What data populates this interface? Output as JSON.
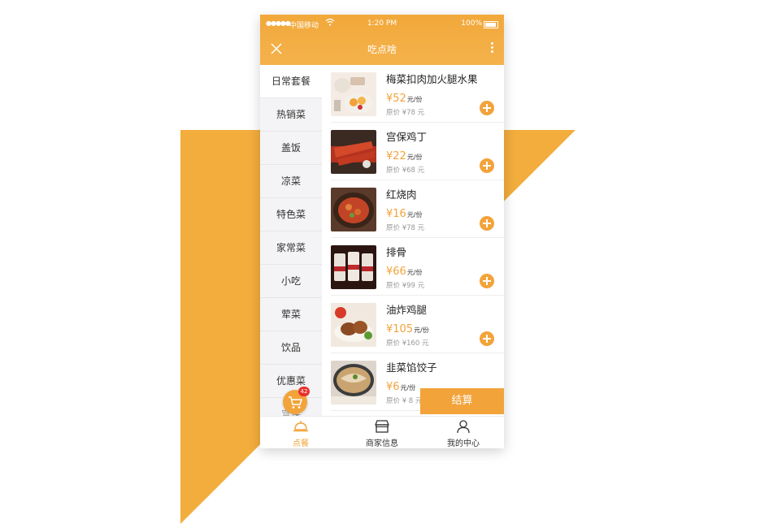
{
  "status_bar": {
    "carrier": "中国移动",
    "time": "1:20 PM",
    "battery": "100%"
  },
  "nav": {
    "title": "吃点啥"
  },
  "categories": [
    {
      "label": "日常套餐"
    },
    {
      "label": "热销菜"
    },
    {
      "label": "盖饭"
    },
    {
      "label": "凉菜"
    },
    {
      "label": "特色菜"
    },
    {
      "label": "家常菜"
    },
    {
      "label": "小吃"
    },
    {
      "label": "荤菜"
    },
    {
      "label": "饮品"
    },
    {
      "label": "优惠菜"
    },
    {
      "label": "宫保"
    }
  ],
  "dishes": [
    {
      "name": "梅菜扣肉加火腿水果",
      "price": "¥52",
      "unit": "元/份",
      "original": "原价 ¥78 元"
    },
    {
      "name": "宫保鸡丁",
      "price": "¥22",
      "unit": "元/份",
      "original": "原价 ¥68 元"
    },
    {
      "name": "红烧肉",
      "price": "¥16",
      "unit": "元/份",
      "original": "原价 ¥78 元"
    },
    {
      "name": "排骨",
      "price": "¥66",
      "unit": "元/份",
      "original": "原价 ¥99 元"
    },
    {
      "name": "油炸鸡腿",
      "price": "¥105",
      "unit": "元/份",
      "original": "原价 ¥160 元"
    },
    {
      "name": "韭菜馅饺子",
      "price": "¥6",
      "unit": "元/份",
      "original": "原价 ¥ 8 元"
    }
  ],
  "cart": {
    "badge": "42",
    "checkout_label": "结算"
  },
  "tabs": [
    {
      "label": "点餐"
    },
    {
      "label": "商家信息"
    },
    {
      "label": "我的中心"
    }
  ],
  "colors": {
    "accent": "#f2a33a",
    "background_shape": "#f2ad3d",
    "badge": "#e8322b"
  },
  "icons": [
    "signal-icon",
    "wifi-icon",
    "battery-icon",
    "close-icon",
    "more-icon",
    "plus-icon",
    "cart-icon",
    "cloche-icon",
    "store-icon",
    "user-icon"
  ]
}
